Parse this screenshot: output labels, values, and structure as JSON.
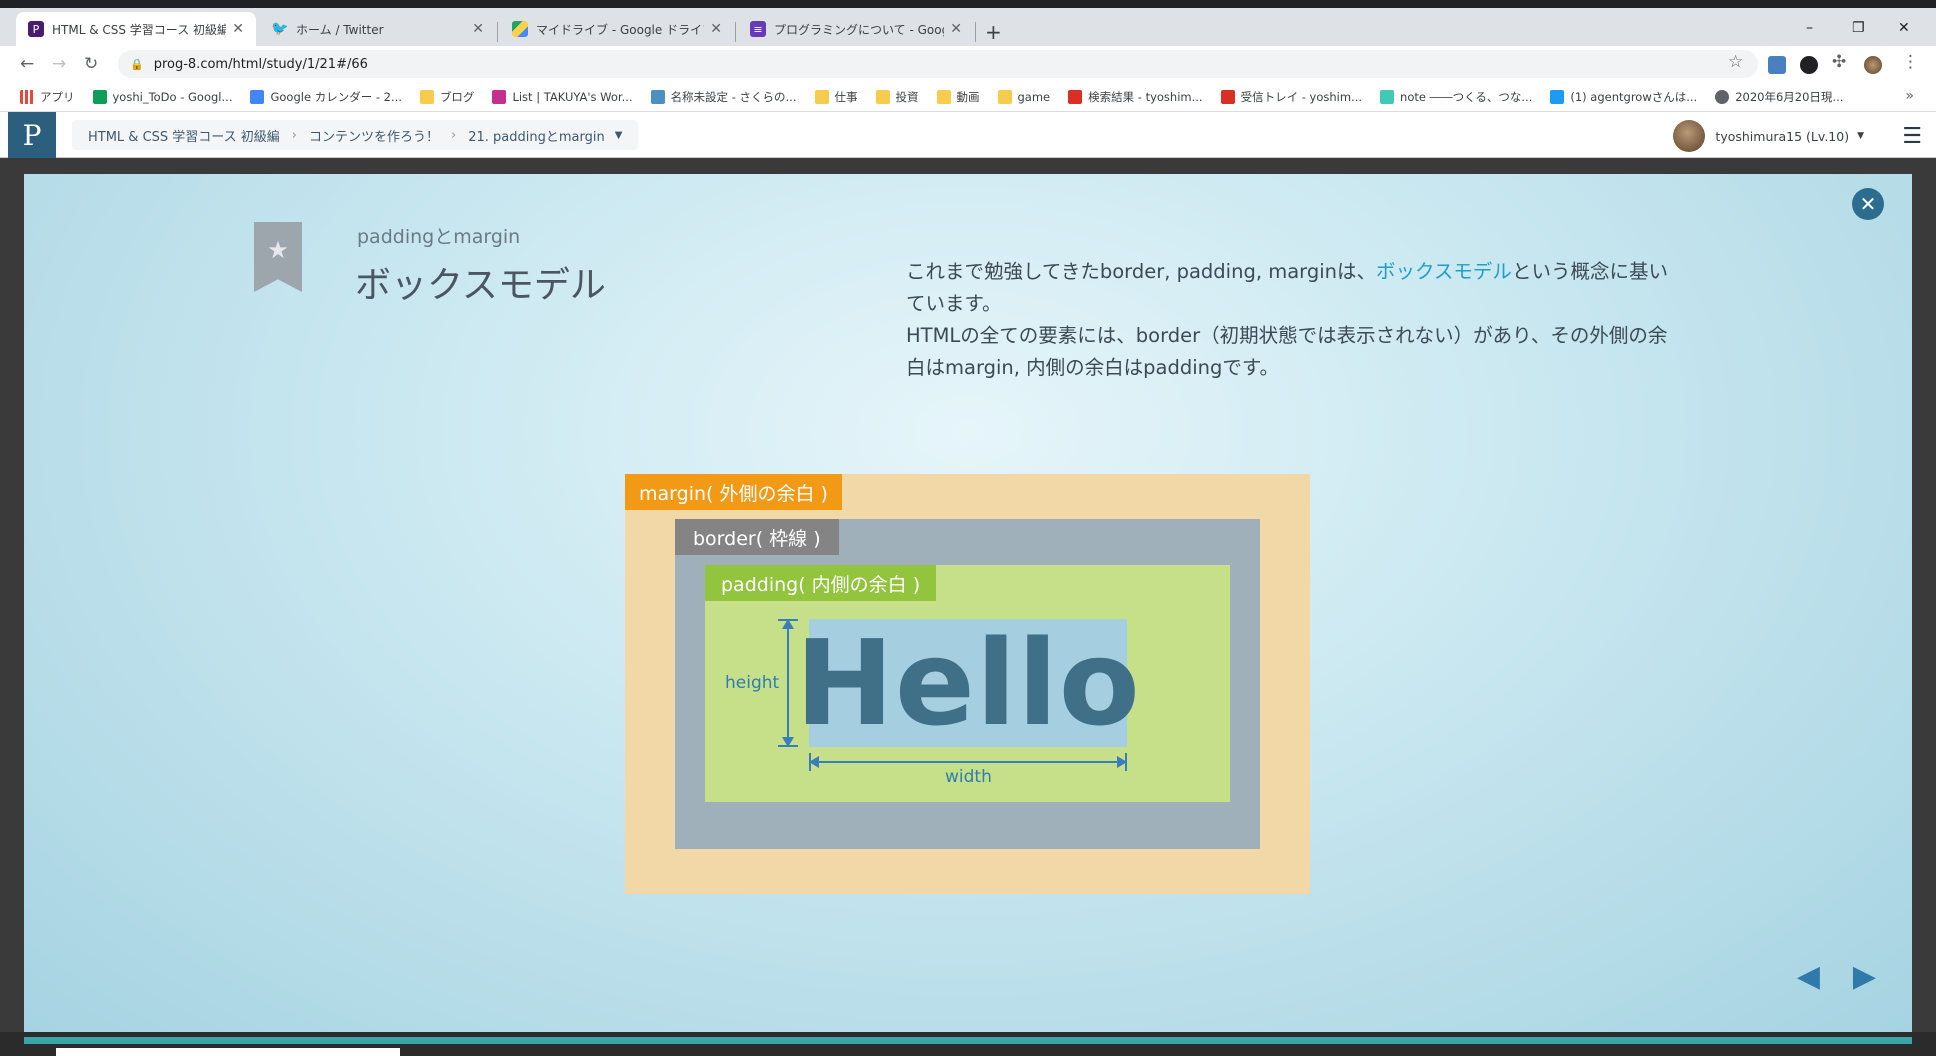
{
  "browser": {
    "tabs": [
      {
        "title": "HTML & CSS 学習コース 初級編 | プ",
        "icon": "progate-icon",
        "color": "#4a1d6b"
      },
      {
        "title": "ホーム / Twitter",
        "icon": "twitter-icon",
        "color": "#1d9bf0"
      },
      {
        "title": "マイドライブ - Google ドライブ",
        "icon": "drive-icon",
        "color": "#1fa463"
      },
      {
        "title": "プログラミングについて - Google フォー",
        "icon": "forms-icon",
        "color": "#673ab7"
      }
    ],
    "new_tab": "+",
    "window_controls": {
      "minimize": "–",
      "restore": "❐",
      "close": "✕"
    },
    "url": "prog-8.com/html/study/1/21#/66",
    "bookmarks": [
      {
        "label": "アプリ",
        "color": "#e8453c"
      },
      {
        "label": "yoshi_ToDo - Googl...",
        "color": "#0f9d58"
      },
      {
        "label": "Google カレンダー - 2...",
        "color": "#4285f4"
      },
      {
        "label": "ブログ",
        "color": "#f7cb4d"
      },
      {
        "label": "List | TAKUYA's Wor...",
        "color": "#c4308e"
      },
      {
        "label": "名称未設定 - さくらの...",
        "color": "#4a90c2"
      },
      {
        "label": "仕事",
        "color": "#f7cb4d"
      },
      {
        "label": "投資",
        "color": "#f7cb4d"
      },
      {
        "label": "動画",
        "color": "#f7cb4d"
      },
      {
        "label": "game",
        "color": "#f7cb4d"
      },
      {
        "label": "検索結果 - tyoshim...",
        "color": "#d93025"
      },
      {
        "label": "受信トレイ - yoshim...",
        "color": "#d93025"
      },
      {
        "label": "note ――つくる、つな...",
        "color": "#41c9b4"
      },
      {
        "label": "(1) agentgrowさんは...",
        "color": "#1d9bf0"
      },
      {
        "label": "2020年6月20日現...",
        "color": "#5f6368"
      }
    ],
    "bookmarks_more": "»"
  },
  "site": {
    "logo": "P",
    "breadcrumbs": [
      "HTML & CSS 学習コース 初級編",
      "コンテンツを作ろう！",
      "21. paddingとmargin"
    ],
    "user_name": "tyoshimura15 (Lv.10)"
  },
  "slide": {
    "subtitle": "paddingとmargin",
    "title": "ボックスモデル",
    "desc_part1": "これまで勉強してきたborder, padding, marginは、",
    "desc_highlight": "ボックスモデル",
    "desc_part2": "という概念に基いています。",
    "desc_line2": "HTMLの全ての要素には、border（初期状態では表示されない）があり、その外側の余白はmargin, 内側の余白はpaddingです。",
    "diagram": {
      "margin_label": "margin( 外側の余白 )",
      "border_label": "border( 枠線 )",
      "padding_label": "padding( 内側の余白 )",
      "content_text": "Hello",
      "height_label": "height",
      "width_label": "width"
    },
    "prev": "◀",
    "next": "▶"
  }
}
